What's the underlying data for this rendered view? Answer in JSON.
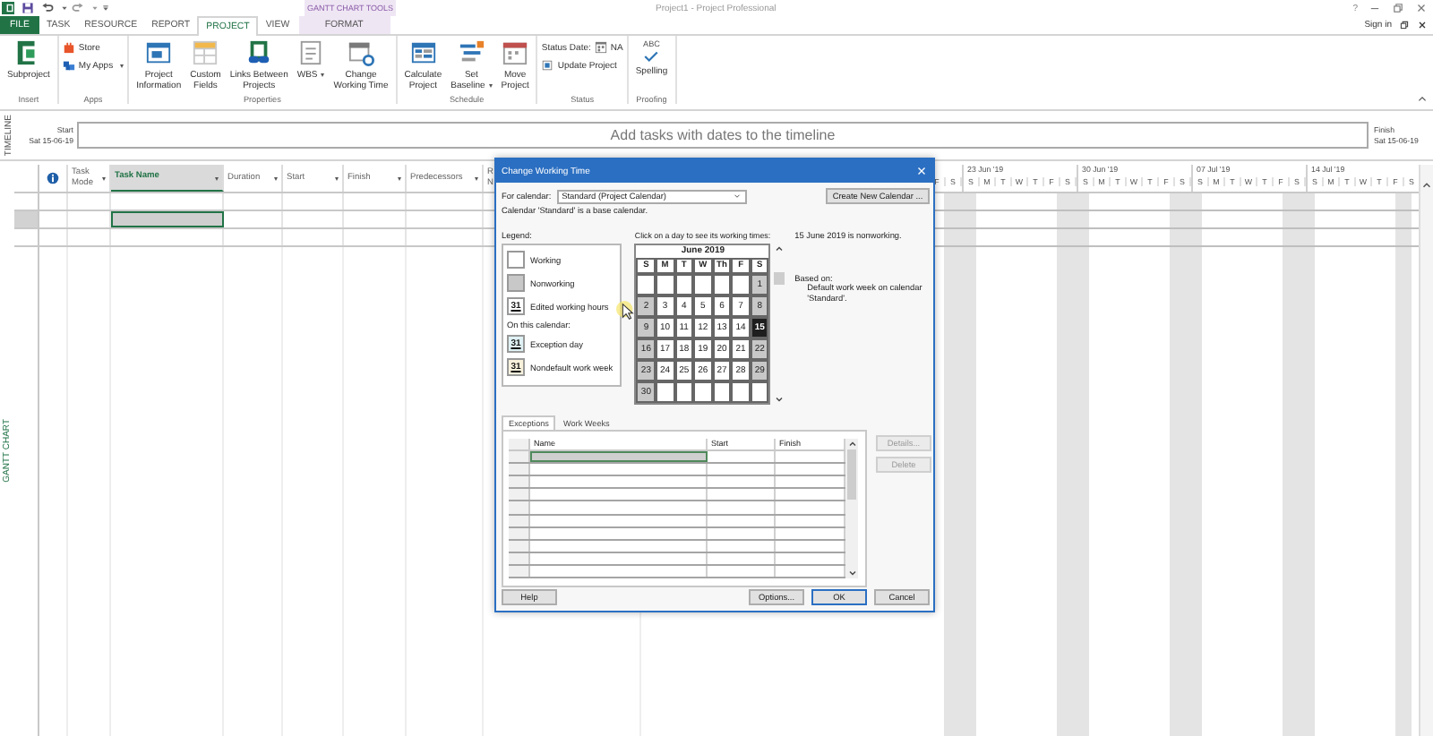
{
  "title_bar": {
    "title": "Project1 - Project Professional",
    "tool_group": "GANTT CHART TOOLS",
    "help": "?"
  },
  "tabs": [
    {
      "label": "FILE",
      "kind": "file",
      "selected": false
    },
    {
      "label": "TASK",
      "kind": "standard",
      "selected": false
    },
    {
      "label": "RESOURCE",
      "kind": "standard",
      "selected": false
    },
    {
      "label": "REPORT",
      "kind": "standard",
      "selected": false
    },
    {
      "label": "PROJECT",
      "kind": "standard",
      "selected": true
    },
    {
      "label": "VIEW",
      "kind": "standard",
      "selected": false
    },
    {
      "label": "FORMAT",
      "kind": "tool",
      "selected": false
    }
  ],
  "account": {
    "label": "Sign in"
  },
  "ribbon": [
    {
      "label": "Insert",
      "commands": [
        {
          "kind": "large",
          "lines": [
            "Subproject"
          ],
          "dropdown": false
        }
      ]
    },
    {
      "label": "Apps",
      "commands": [
        {
          "kind": "small",
          "label": "Store",
          "dropdown": false
        },
        {
          "kind": "small",
          "label": "My Apps",
          "dropdown": true
        }
      ]
    },
    {
      "label": "Properties",
      "commands": [
        {
          "kind": "large",
          "lines": [
            "Project",
            "Information"
          ],
          "dropdown": false
        },
        {
          "kind": "large",
          "lines": [
            "Custom",
            "Fields"
          ],
          "dropdown": false
        },
        {
          "kind": "large",
          "lines": [
            "Links Between",
            "Projects"
          ],
          "dropdown": false
        },
        {
          "kind": "large",
          "lines": [
            "WBS"
          ],
          "dropdown": true
        },
        {
          "kind": "large",
          "lines": [
            "Change",
            "Working Time"
          ],
          "dropdown": false
        }
      ]
    },
    {
      "label": "Schedule",
      "commands": [
        {
          "kind": "large",
          "lines": [
            "Calculate",
            "Project"
          ],
          "dropdown": false
        },
        {
          "kind": "large",
          "lines": [
            "Set",
            "Baseline"
          ],
          "dropdown": true
        },
        {
          "kind": "large",
          "lines": [
            "Move",
            "Project"
          ],
          "dropdown": false
        }
      ]
    },
    {
      "label": "Status",
      "commands": [
        {
          "kind": "status",
          "label": "Status Date:",
          "value": "NA"
        },
        {
          "kind": "small",
          "label": "Update Project",
          "dropdown": false
        }
      ]
    },
    {
      "label": "Proofing",
      "commands": [
        {
          "kind": "spelling",
          "lines": [
            "Spelling"
          ],
          "glyph": "ABC"
        }
      ]
    }
  ],
  "timeline": {
    "side_label": "TIMELINE",
    "start_label": "Start",
    "start_date": "Sat 15-06-19",
    "hint": "Add tasks with dates to the timeline",
    "finish_label": "Finish",
    "finish_date": "Sat 15-06-19"
  },
  "view_label": "GANTT CHART",
  "table": {
    "columns": [
      {
        "kind": "info",
        "selected": false
      },
      {
        "kind": "text",
        "lines": [
          "Task",
          "Mode"
        ],
        "selected": false
      },
      {
        "kind": "text",
        "lines": [
          "Task Name"
        ],
        "selected": true
      },
      {
        "kind": "text",
        "lines": [
          "Duration"
        ],
        "selected": false
      },
      {
        "kind": "text",
        "lines": [
          "Start"
        ],
        "selected": false
      },
      {
        "kind": "text",
        "lines": [
          "Finish"
        ],
        "selected": false
      },
      {
        "kind": "text",
        "lines": [
          "Predecessors"
        ],
        "selected": false
      },
      {
        "kind": "cut",
        "lines": [
          "R",
          "N"
        ],
        "selected": false
      }
    ],
    "rows": [
      {
        "selected": false
      },
      {
        "selected": true
      },
      {
        "selected": false
      }
    ]
  },
  "gantt": {
    "leading_days": [
      {
        "letter": "F",
        "weekend": false
      },
      {
        "letter": "S",
        "weekend": true
      }
    ],
    "weeks": [
      {
        "label": "23 Jun '19",
        "days": [
          {
            "letter": "S",
            "weekend": true
          },
          {
            "letter": "M",
            "weekend": false
          },
          {
            "letter": "T",
            "weekend": false
          },
          {
            "letter": "W",
            "weekend": false
          },
          {
            "letter": "T",
            "weekend": false
          },
          {
            "letter": "F",
            "weekend": false
          },
          {
            "letter": "S",
            "weekend": true
          }
        ]
      },
      {
        "label": "30 Jun '19",
        "days": [
          {
            "letter": "S",
            "weekend": true
          },
          {
            "letter": "M",
            "weekend": false
          },
          {
            "letter": "T",
            "weekend": false
          },
          {
            "letter": "W",
            "weekend": false
          },
          {
            "letter": "T",
            "weekend": false
          },
          {
            "letter": "F",
            "weekend": false
          },
          {
            "letter": "S",
            "weekend": true
          }
        ]
      },
      {
        "label": "07 Jul '19",
        "days": [
          {
            "letter": "S",
            "weekend": true
          },
          {
            "letter": "M",
            "weekend": false
          },
          {
            "letter": "T",
            "weekend": false
          },
          {
            "letter": "W",
            "weekend": false
          },
          {
            "letter": "T",
            "weekend": false
          },
          {
            "letter": "F",
            "weekend": false
          },
          {
            "letter": "S",
            "weekend": true
          }
        ]
      },
      {
        "label": "14 Jul '19",
        "days": [
          {
            "letter": "S",
            "weekend": true
          },
          {
            "letter": "M",
            "weekend": false
          },
          {
            "letter": "T",
            "weekend": false
          },
          {
            "letter": "W",
            "weekend": false
          },
          {
            "letter": "T",
            "weekend": false
          },
          {
            "letter": "F",
            "weekend": false
          },
          {
            "letter": "S",
            "weekend": true
          }
        ]
      }
    ]
  },
  "dialog": {
    "title": "Change Working Time",
    "for_calendar_label": "For calendar:",
    "calendar_value": "Standard (Project Calendar)",
    "create_button": "Create New Calendar ...",
    "base_note": "Calendar 'Standard' is a base calendar.",
    "legend_label": "Legend:",
    "legend": [
      {
        "kind": "working",
        "label": "Working"
      },
      {
        "kind": "nonworking",
        "label": "Nonworking"
      },
      {
        "kind": "edited",
        "label": "Edited working hours",
        "glyph": "31"
      },
      {
        "kind": "heading",
        "label": "On this calendar:"
      },
      {
        "kind": "exception",
        "label": "Exception day",
        "glyph": "31"
      },
      {
        "kind": "nondefault",
        "label": "Nondefault work week",
        "glyph": "31"
      }
    ],
    "calendar_prompt": "Click on a day to see its working times:",
    "month": "June 2019",
    "weekdays": [
      "S",
      "M",
      "T",
      "W",
      "Th",
      "F",
      "S"
    ],
    "weeks": [
      [
        {
          "kind": "blank"
        },
        {
          "kind": "blank"
        },
        {
          "kind": "blank"
        },
        {
          "kind": "blank"
        },
        {
          "kind": "blank"
        },
        {
          "kind": "blank"
        },
        {
          "kind": "day",
          "day": "1",
          "nonworking": true,
          "selected": false
        }
      ],
      [
        {
          "kind": "day",
          "day": "2",
          "nonworking": true,
          "selected": false
        },
        {
          "kind": "day",
          "day": "3",
          "nonworking": false,
          "selected": false
        },
        {
          "kind": "day",
          "day": "4",
          "nonworking": false,
          "selected": false
        },
        {
          "kind": "day",
          "day": "5",
          "nonworking": false,
          "selected": false
        },
        {
          "kind": "day",
          "day": "6",
          "nonworking": false,
          "selected": false
        },
        {
          "kind": "day",
          "day": "7",
          "nonworking": false,
          "selected": false
        },
        {
          "kind": "day",
          "day": "8",
          "nonworking": true,
          "selected": false
        }
      ],
      [
        {
          "kind": "day",
          "day": "9",
          "nonworking": true,
          "selected": false
        },
        {
          "kind": "day",
          "day": "10",
          "nonworking": false,
          "selected": false
        },
        {
          "kind": "day",
          "day": "11",
          "nonworking": false,
          "selected": false
        },
        {
          "kind": "day",
          "day": "12",
          "nonworking": false,
          "selected": false
        },
        {
          "kind": "day",
          "day": "13",
          "nonworking": false,
          "selected": false
        },
        {
          "kind": "day",
          "day": "14",
          "nonworking": false,
          "selected": false
        },
        {
          "kind": "day",
          "day": "15",
          "nonworking": true,
          "selected": true
        }
      ],
      [
        {
          "kind": "day",
          "day": "16",
          "nonworking": true,
          "selected": false
        },
        {
          "kind": "day",
          "day": "17",
          "nonworking": false,
          "selected": false
        },
        {
          "kind": "day",
          "day": "18",
          "nonworking": false,
          "selected": false
        },
        {
          "kind": "day",
          "day": "19",
          "nonworking": false,
          "selected": false
        },
        {
          "kind": "day",
          "day": "20",
          "nonworking": false,
          "selected": false
        },
        {
          "kind": "day",
          "day": "21",
          "nonworking": false,
          "selected": false
        },
        {
          "kind": "day",
          "day": "22",
          "nonworking": true,
          "selected": false
        }
      ],
      [
        {
          "kind": "day",
          "day": "23",
          "nonworking": true,
          "selected": false
        },
        {
          "kind": "day",
          "day": "24",
          "nonworking": false,
          "selected": false
        },
        {
          "kind": "day",
          "day": "25",
          "nonworking": false,
          "selected": false
        },
        {
          "kind": "day",
          "day": "26",
          "nonworking": false,
          "selected": false
        },
        {
          "kind": "day",
          "day": "27",
          "nonworking": false,
          "selected": false
        },
        {
          "kind": "day",
          "day": "28",
          "nonworking": false,
          "selected": false
        },
        {
          "kind": "day",
          "day": "29",
          "nonworking": true,
          "selected": false
        }
      ],
      [
        {
          "kind": "day",
          "day": "30",
          "nonworking": true,
          "selected": false
        },
        {
          "kind": "blank"
        },
        {
          "kind": "blank"
        },
        {
          "kind": "blank"
        },
        {
          "kind": "blank"
        },
        {
          "kind": "blank"
        },
        {
          "kind": "blank"
        }
      ]
    ],
    "day_status": "15 June 2019 is nonworking.",
    "based_on_label": "Based on:",
    "based_on_text": "Default work week on calendar 'Standard'.",
    "tabs": [
      {
        "label": "Exceptions",
        "selected": true
      },
      {
        "label": "Work Weeks",
        "selected": false
      }
    ],
    "exceptions": {
      "columns": [
        "Name",
        "Start",
        "Finish"
      ],
      "rows": [
        {
          "selected": true
        },
        {
          "selected": false
        },
        {
          "selected": false
        },
        {
          "selected": false
        },
        {
          "selected": false
        },
        {
          "selected": false
        },
        {
          "selected": false
        },
        {
          "selected": false
        },
        {
          "selected": false
        },
        {
          "selected": false
        }
      ]
    },
    "side_buttons": [
      {
        "label": "Details...",
        "disabled": true
      },
      {
        "label": "Delete",
        "disabled": true
      }
    ],
    "help_button": "Help",
    "buttons": [
      {
        "label": "Options...",
        "default": false
      },
      {
        "label": "OK",
        "default": true
      },
      {
        "label": "Cancel",
        "default": false
      }
    ]
  }
}
